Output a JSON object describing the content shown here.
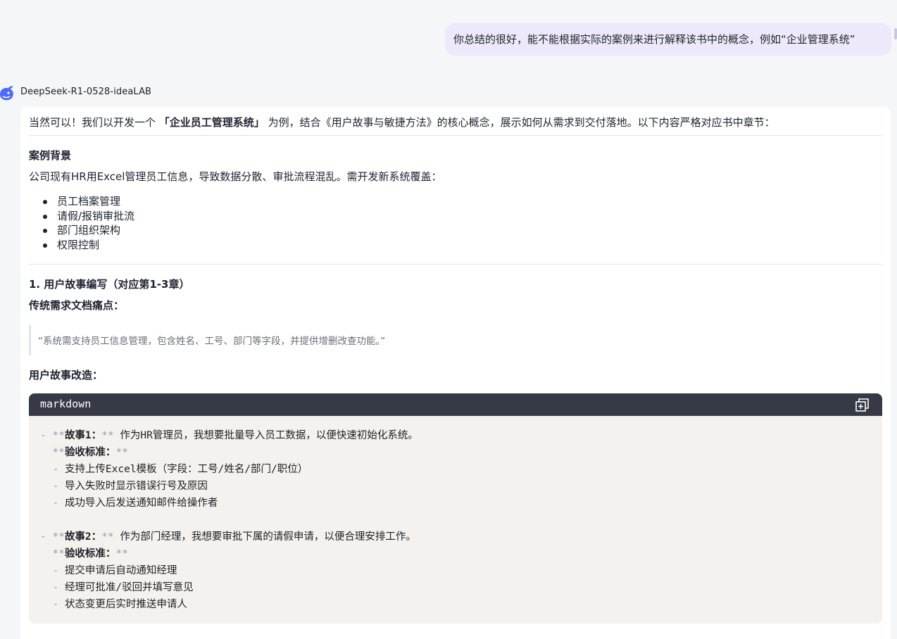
{
  "user_message": "你总结的很好，能不能根据实际的案例来进行解释该书中的概念，例如“企业管理系统”",
  "assistant": {
    "name": "DeepSeek-R1-0528-ideaLAB",
    "intro_pre": "当然可以！我们以开发一个 ",
    "intro_bold": "「企业员工管理系统」",
    "intro_post": " 为例，结合《用户故事与敏捷方法》的核心概念，展示如何从需求到交付落地。以下内容严格对应书中章节："
  },
  "background": {
    "heading": "案例背景",
    "text": "公司现有HR用Excel管理员工信息，导致数据分散、审批流程混乱。需开发新系统覆盖：",
    "items": [
      "员工档案管理",
      "请假/报销审批流",
      "部门组织架构",
      "权限控制"
    ]
  },
  "section1": {
    "heading": "1. 用户故事编写（对应第1-3章）",
    "pain_heading": "传统需求文档痛点：",
    "quote": "“系统需支持员工信息管理，包含姓名、工号、部门等字段，并提供增删改查功能。”",
    "rewrite_heading": "用户故事改造："
  },
  "code_block": {
    "language": "markdown",
    "lines": [
      [
        [
          "- ",
          "dim"
        ],
        [
          "**",
          "dim"
        ],
        [
          "故事1：",
          "bold"
        ],
        [
          "** ",
          "dim"
        ],
        [
          "作为HR管理员，我想要批量导入员工数据，以便快速初始化系统。",
          "text"
        ]
      ],
      [
        [
          "  ",
          "text"
        ],
        [
          "**",
          "dim"
        ],
        [
          "验收标准：",
          "bold"
        ],
        [
          "**",
          "dim"
        ]
      ],
      [
        [
          "  ",
          "text"
        ],
        [
          "- ",
          "dim"
        ],
        [
          "支持上传Excel模板（字段：工号/姓名/部门/职位）",
          "text"
        ]
      ],
      [
        [
          "  ",
          "text"
        ],
        [
          "- ",
          "dim"
        ],
        [
          "导入失败时显示错误行号及原因",
          "text"
        ]
      ],
      [
        [
          "  ",
          "text"
        ],
        [
          "- ",
          "dim"
        ],
        [
          "成功导入后发送通知邮件给操作者",
          "text"
        ]
      ],
      [],
      [
        [
          "- ",
          "dim"
        ],
        [
          "**",
          "dim"
        ],
        [
          "故事2：",
          "bold"
        ],
        [
          "** ",
          "dim"
        ],
        [
          "作为部门经理，我想要审批下属的请假申请，以便合理安排工作。",
          "text"
        ]
      ],
      [
        [
          "  ",
          "text"
        ],
        [
          "**",
          "dim"
        ],
        [
          "验收标准：",
          "bold"
        ],
        [
          "**",
          "dim"
        ]
      ],
      [
        [
          "  ",
          "text"
        ],
        [
          "- ",
          "dim"
        ],
        [
          "提交申请后自动通知经理",
          "text"
        ]
      ],
      [
        [
          "  ",
          "text"
        ],
        [
          "- ",
          "dim"
        ],
        [
          "经理可批准/驳回并填写意见",
          "text"
        ]
      ],
      [
        [
          "  ",
          "text"
        ],
        [
          "- ",
          "dim"
        ],
        [
          "状态变更后实时推送申请人",
          "text"
        ]
      ]
    ]
  },
  "colors": {
    "user_bubble": "#ede9fb",
    "code_header": "#363a46",
    "code_body": "#f4f1ee",
    "avatar_accent": "#4d6bfe"
  }
}
